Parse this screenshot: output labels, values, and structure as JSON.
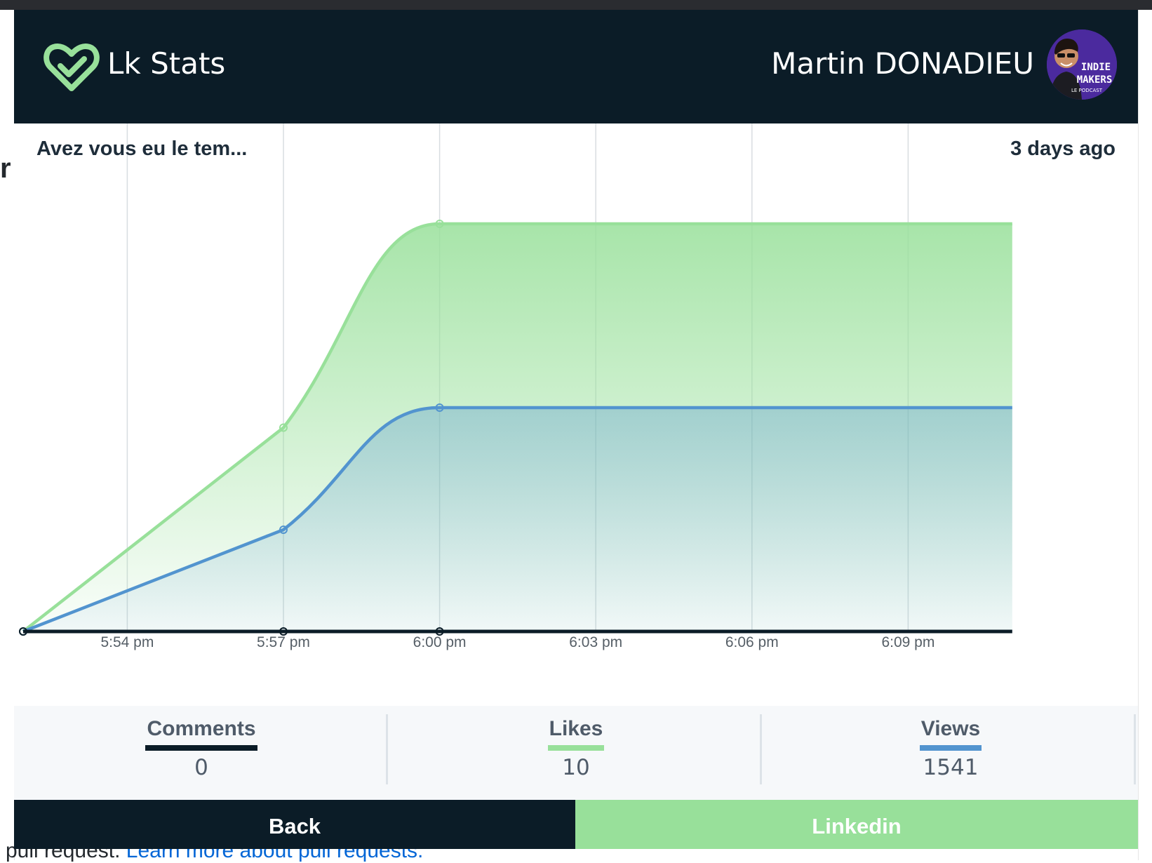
{
  "app": {
    "title": "Lk Stats"
  },
  "user": {
    "name": "Martin DONADIEU",
    "avatar_text": [
      "INDIE",
      "MAKERS",
      "LE PODCAST"
    ]
  },
  "post": {
    "title": "Avez vous eu le tem...",
    "date": "3 days ago"
  },
  "stats": [
    {
      "label": "Comments",
      "value": "0",
      "color": "#0b1c27"
    },
    {
      "label": "Likes",
      "value": "10",
      "color": "#98e09a"
    },
    {
      "label": "Views",
      "value": "1541",
      "color": "#5294cf"
    }
  ],
  "buttons": {
    "back": "Back",
    "linkedin": "Linkedin"
  },
  "colors": {
    "header_bg": "#0b1c27",
    "likes": "#98e09a",
    "views": "#5294cf",
    "comments": "#0b1c27"
  },
  "background_page": {
    "text_prefix": "pull request.",
    "link_text": "Learn more about pull requests."
  },
  "chart_data": {
    "type": "area",
    "x": [
      "5:52 pm",
      "5:57 pm",
      "6:00 pm",
      "6:11 pm"
    ],
    "xticks": [
      "5:54 pm",
      "5:57 pm",
      "6:00 pm",
      "6:03 pm",
      "6:06 pm",
      "6:09 pm"
    ],
    "series": [
      {
        "name": "Likes",
        "values": [
          0,
          5,
          10,
          10
        ],
        "color": "#98e09a"
      },
      {
        "name": "Views",
        "values": [
          0,
          250,
          550,
          550
        ],
        "color": "#5294cf"
      },
      {
        "name": "Comments",
        "values": [
          0,
          0,
          0,
          0
        ],
        "color": "#0b1c27"
      }
    ],
    "grid": true,
    "legend": "bottom"
  }
}
